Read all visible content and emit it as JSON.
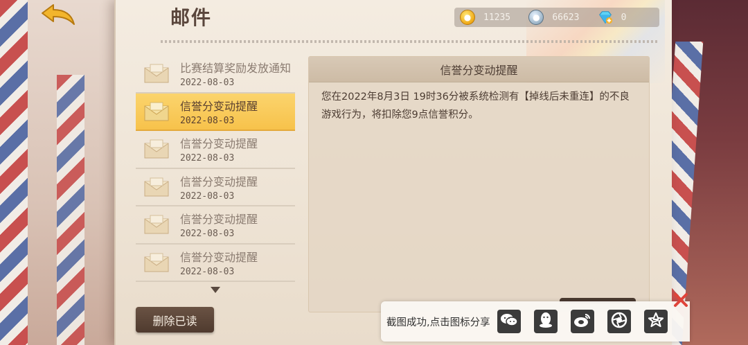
{
  "header": {
    "title": "邮件",
    "back_icon": "back-arrow-icon"
  },
  "currency": [
    {
      "icon": "gold-coin-icon",
      "value": "11235"
    },
    {
      "icon": "silver-coin-icon",
      "value": "66623"
    },
    {
      "icon": "diamond-add-icon",
      "value": "0"
    }
  ],
  "mail_list": {
    "items": [
      {
        "title": "比赛结算奖励发放通知",
        "date": "2022-08-03",
        "selected": false
      },
      {
        "title": "信誉分变动提醒",
        "date": "2022-08-03",
        "selected": true
      },
      {
        "title": "信誉分变动提醒",
        "date": "2022-08-03",
        "selected": false
      },
      {
        "title": "信誉分变动提醒",
        "date": "2022-08-03",
        "selected": false
      },
      {
        "title": "信誉分变动提醒",
        "date": "2022-08-03",
        "selected": false
      },
      {
        "title": "信誉分变动提醒",
        "date": "2022-08-03",
        "selected": false
      }
    ],
    "delete_read_label": "删除已读"
  },
  "detail": {
    "title": "信誉分变动提醒",
    "body": "您在2022年8月3日 19时36分被系统检测有【掉线后未重连】的不良游戏行为，将扣除您9点信誉积分。"
  },
  "share": {
    "text": "截图成功,点击图标分享",
    "targets": [
      "wechat-icon",
      "qq-icon",
      "weibo-icon",
      "camera-aperture-icon",
      "star-icon"
    ]
  },
  "colors": {
    "selected_row": "#f7c24b",
    "button_dark": "#4f3a2e",
    "gold": "#f0a916"
  }
}
